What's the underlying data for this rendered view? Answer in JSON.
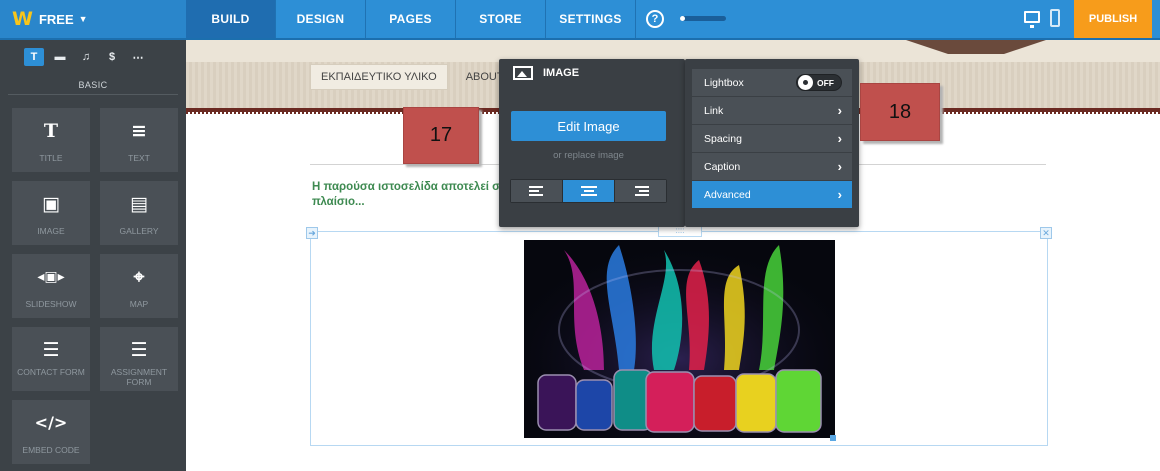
{
  "topbar": {
    "brand": "FREE",
    "tabs": [
      {
        "label": "BUILD",
        "active": true
      },
      {
        "label": "DESIGN",
        "active": false
      },
      {
        "label": "PAGES",
        "active": false
      },
      {
        "label": "STORE",
        "active": false
      },
      {
        "label": "SETTINGS",
        "active": false
      }
    ],
    "help": "?",
    "publish": "PUBLISH"
  },
  "sidebar": {
    "category_icons": [
      "text-icon",
      "layout-icon",
      "media-icon",
      "dollar-icon",
      "more-icon"
    ],
    "category_glyphs": [
      "T",
      "▬",
      "♫",
      "$",
      "⋯"
    ],
    "section_label": "BASIC",
    "tiles": [
      {
        "label": "TITLE",
        "icon": "T"
      },
      {
        "label": "TEXT",
        "icon": "≡"
      },
      {
        "label": "IMAGE",
        "icon": "▣"
      },
      {
        "label": "GALLERY",
        "icon": "▤"
      },
      {
        "label": "SLIDESHOW",
        "icon": "◂▣▸"
      },
      {
        "label": "MAP",
        "icon": "⌖"
      },
      {
        "label": "CONTACT FORM",
        "icon": "☰"
      },
      {
        "label": "ASSIGNMENT FORM",
        "icon": "☰"
      },
      {
        "label": "EMBED CODE",
        "icon": "</>"
      }
    ]
  },
  "canvas": {
    "menu": [
      "ΕΚΠΑΙΔΕΥΤΙΚΟ ΥΛΙΚΟ",
      "ABOUT"
    ],
    "body_text": "Η παρούσα ιστοσελίδα αποτελεί στο πλαίσιο...",
    "box_move_glyph": "➜",
    "box_close_glyph": "✕",
    "drag_glyph": "::::"
  },
  "popup": {
    "title": "IMAGE",
    "edit_button": "Edit Image",
    "replace_link": "or replace image",
    "alignment": [
      "left",
      "center",
      "right"
    ],
    "alignment_selected": "center",
    "options": [
      {
        "label": "Lightbox",
        "type": "toggle",
        "value": "OFF"
      },
      {
        "label": "Link",
        "type": "arrow"
      },
      {
        "label": "Spacing",
        "type": "arrow"
      },
      {
        "label": "Caption",
        "type": "arrow"
      },
      {
        "label": "Advanced",
        "type": "arrow"
      }
    ],
    "arrow_glyph": "›"
  },
  "callouts": [
    "17",
    "18"
  ],
  "colors": {
    "accent": "#2d8fd6",
    "publish": "#f79c1b",
    "callout": "#c0504d",
    "body_text": "#3e8a51"
  }
}
